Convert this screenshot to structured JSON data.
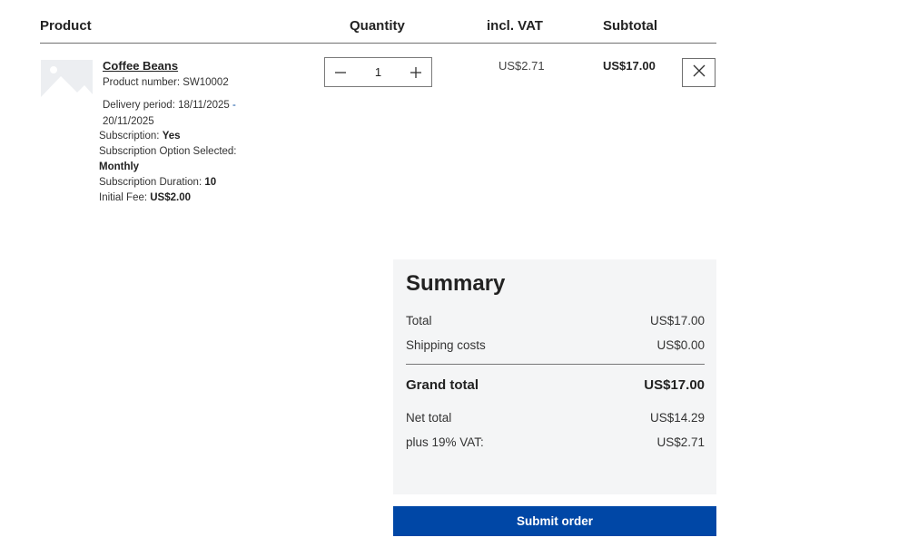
{
  "table_header": {
    "product": "Product",
    "quantity": "Quantity",
    "incl_vat": "incl. VAT",
    "subtotal": "Subtotal"
  },
  "line_item": {
    "image_icon": "image-placeholder-icon",
    "name": "Coffee Beans",
    "product_number": "Product number: SW10002",
    "delivery_label": "Delivery period: 18/11/2025",
    "delivery_sep": "-",
    "delivery_end": "20/11/2025",
    "subscription_label": "Subscription: ",
    "subscription_value": "Yes",
    "option_label": "Subscription Option Selected:",
    "option_value": "Monthly",
    "duration_label": "Subscription Duration: ",
    "duration_value": "10",
    "fee_label": "Initial Fee: ",
    "fee_value": "US$2.00",
    "quantity": "1",
    "minus_icon": "minus-icon",
    "plus_icon": "plus-icon",
    "incl_vat": "US$2.71",
    "subtotal": "US$17.00",
    "remove_icon": "close-icon"
  },
  "summary": {
    "title": "Summary",
    "total_label": "Total",
    "total_value": "US$17.00",
    "shipping_label": "Shipping costs",
    "shipping_value": "US$0.00",
    "grand_label": "Grand total",
    "grand_value": "US$17.00",
    "net_label": "Net total",
    "net_value": "US$14.29",
    "vat_label": "plus 19% VAT:",
    "vat_value": "US$2.71"
  },
  "actions": {
    "submit_label": "Submit order"
  },
  "colors": {
    "accent": "#0047a6",
    "summary_bg": "#f4f5f6"
  }
}
